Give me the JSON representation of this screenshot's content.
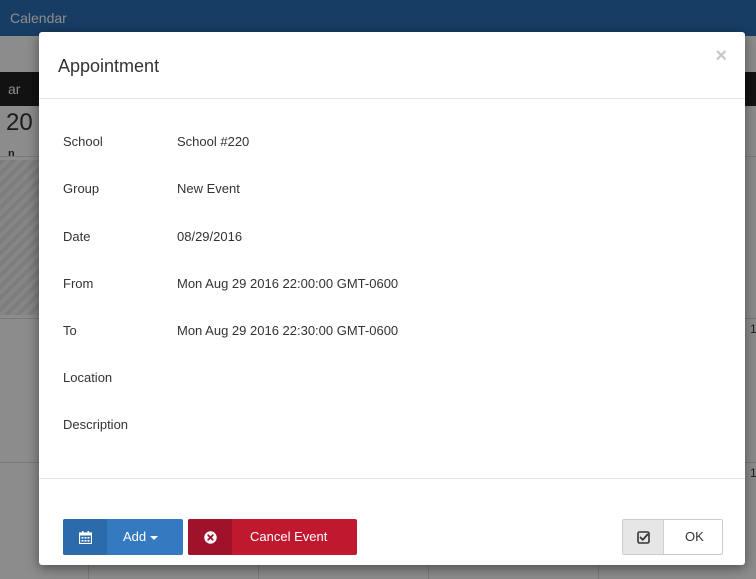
{
  "background": {
    "app_title": "Calendar",
    "toolbar_title": "ar",
    "heading": "20",
    "column_header": "n",
    "day_numbers": [
      "1",
      "1"
    ]
  },
  "modal": {
    "title": "Appointment",
    "close_symbol": "×",
    "fields": [
      {
        "label": "School",
        "value": "School #220"
      },
      {
        "label": "Group",
        "value": "New Event"
      },
      {
        "label": "Date",
        "value": "08/29/2016"
      },
      {
        "label": "From",
        "value": "Mon Aug 29 2016 22:00:00 GMT-0600"
      },
      {
        "label": "To",
        "value": "Mon Aug 29 2016 22:30:00 GMT-0600"
      },
      {
        "label": "Location",
        "value": ""
      },
      {
        "label": "Description",
        "value": ""
      }
    ],
    "footer": {
      "add_label": "Add",
      "add_icon": "calendar-icon",
      "cancel_label": "Cancel Event",
      "cancel_icon": "times-circle-icon",
      "ok_label": "OK",
      "ok_icon": "check-square-icon"
    }
  },
  "colors": {
    "primary": "#3579c0",
    "danger": "#c0182f",
    "topbar": "#2c6fb7"
  }
}
